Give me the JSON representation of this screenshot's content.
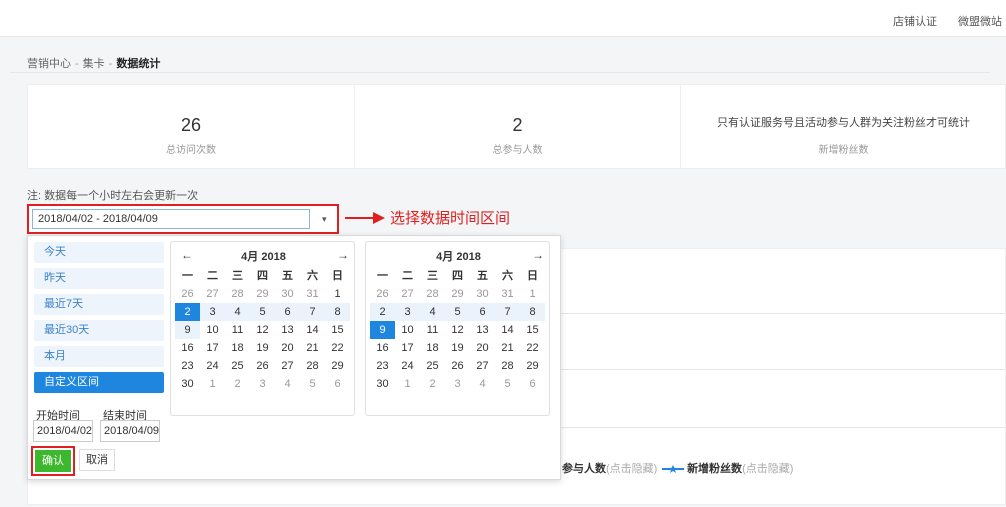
{
  "topbar": {
    "link1": "店铺认证",
    "link2": "微盟微站"
  },
  "breadcrumb": {
    "item1": "营销中心",
    "sep": "-",
    "item2": "集卡",
    "current": "数据统计"
  },
  "stats": [
    {
      "value": "26",
      "label": "总访问次数"
    },
    {
      "value": "2",
      "label": "总参与人数"
    },
    {
      "note": "只有认证服务号且活动参与人群为关注粉丝才可统计",
      "label": "新增粉丝数"
    }
  ],
  "notice": "注: 数据每一个小时左右会更新一次",
  "date_range": {
    "value": "2018/04/02 - 2018/04/09",
    "caret": "▾"
  },
  "annotation": "选择数据时间区间",
  "ranges": [
    "今天",
    "昨天",
    "最近7天",
    "最近30天",
    "本月",
    "自定义区间"
  ],
  "start_label": "开始时间",
  "end_label": "结束时间",
  "start_value": "2018/04/02",
  "end_value": "2018/04/09",
  "confirm": "确认",
  "cancel": "取消",
  "calendars": [
    {
      "title": "4月 2018",
      "prev": "←",
      "next": "→"
    },
    {
      "title": "4月 2018",
      "next": "→"
    }
  ],
  "weekdays": [
    "一",
    "二",
    "三",
    "四",
    "五",
    "六",
    "日"
  ],
  "legend": {
    "series1": "参与人数",
    "hint1": "(点击隐藏)",
    "series2": "新增粉丝数",
    "hint2": "(点击隐藏)"
  },
  "colors": {
    "accent": "#1f86e0",
    "annotation": "#e02020",
    "confirm": "#3cb72e"
  }
}
